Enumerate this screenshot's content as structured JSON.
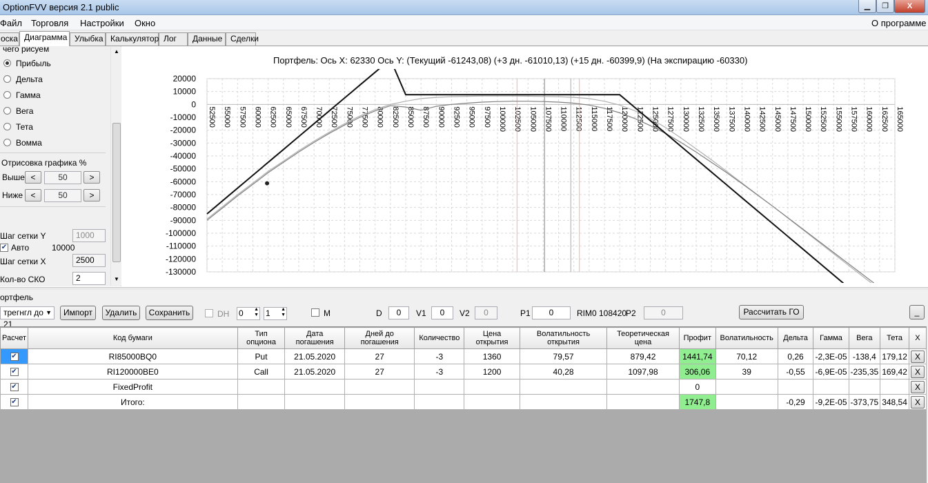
{
  "window": {
    "title": "OptionFVV версия 2.1 public",
    "minimize": "▁",
    "maximize": "❐",
    "close": "X"
  },
  "menu": {
    "items": [
      "Файл",
      "Торговля",
      "Настройки",
      "Окно"
    ],
    "about": "О программе"
  },
  "tabs": [
    "оска",
    "Диаграмма",
    "Улыбка",
    "Калькулятор",
    "Лог",
    "Данные",
    "Сделки"
  ],
  "left_panel": {
    "group_title": "чего рисуем",
    "options": [
      "Прибыль",
      "Дельта",
      "Гамма",
      "Вега",
      "Тета",
      "Вомма"
    ],
    "selected_index": 0,
    "draw_group_title": "Отрисовка графика %",
    "above_label": "Выше",
    "above_value": "50",
    "below_label": "Ниже",
    "below_value": "50",
    "prev_symbol": "<",
    "next_symbol": ">",
    "grid_y_label": "Шаг сетки Y",
    "grid_y_value": "1000",
    "auto_label": "Авто",
    "auto_checked": true,
    "auto_value": "10000",
    "grid_x_label": "Шаг сетки X",
    "grid_x_value": "2500",
    "sko_label": "Кол-во СКО",
    "sko_value": "2"
  },
  "chart_title": "Портфель: Ось X: 62330 Ось Y:  (Текущий -61243,08)  (+3 дн. -61010,13)  (+15 дн. -60399,9)  (На экспирацию -60330)",
  "chart_data": {
    "type": "line",
    "x": [
      52500,
      55000,
      57500,
      60000,
      62500,
      65000,
      67500,
      70000,
      72500,
      75000,
      77500,
      80000,
      82500,
      85000,
      87500,
      90000,
      92500,
      95000,
      97500,
      100000,
      102500,
      105000,
      107500,
      110000,
      112500,
      115000,
      117500,
      120000,
      122500,
      125000,
      127500,
      130000,
      132500,
      135000,
      137500,
      140000,
      145000,
      150000,
      155000,
      160000,
      162500
    ],
    "x_ticks": [
      "52500",
      "55000",
      "57500",
      "60000",
      "62500",
      "65000",
      "67500",
      "70000",
      "72500",
      "75000",
      "77500",
      "80000",
      "82500",
      "85000",
      "87500",
      "90000",
      "92500",
      "95000",
      "97500",
      "100000",
      "102500",
      "105000",
      "107500",
      "110000",
      "112500",
      "115000",
      "117500",
      "120000",
      "122500",
      "125000",
      "127500",
      "130000",
      "132500",
      "135000",
      "137500",
      "140000",
      "142500",
      "145000",
      "147500",
      "150000",
      "152500",
      "155000",
      "157500",
      "160000",
      "162500",
      "165000"
    ],
    "y_ticks": [
      "20000",
      "10000",
      "0",
      "-10000",
      "-20000",
      "-30000",
      "-40000",
      "-50000",
      "-60000",
      "-70000",
      "-80000",
      "-90000",
      "-100000",
      "-110000",
      "-120000",
      "-130000"
    ],
    "xlim": [
      52500,
      165000
    ],
    "ylim": [
      -130000,
      20000
    ],
    "grid": true,
    "series": [
      {
        "color": "#111111",
        "values": [
          -85000,
          -75000,
          -65000,
          -55000,
          -45000,
          -35000,
          -25000,
          -15000,
          -5000,
          5000,
          15000,
          25000,
          35000,
          7500,
          7500,
          7500,
          7500,
          7500,
          7500,
          7500,
          7500,
          7500,
          7500,
          7500,
          7500,
          7500,
          7500,
          7500,
          -2500,
          -12500,
          -22500,
          -32500,
          -42500,
          -52500,
          -62500,
          -72500,
          -92500,
          -112500,
          -132500,
          -152500,
          -162500
        ]
      },
      {
        "color": "#808080",
        "values": [
          -90000,
          -80500,
          -71000,
          -62000,
          -53000,
          -45000,
          -37000,
          -29500,
          -22500,
          -16000,
          -10000,
          -5000,
          -1000,
          -2000,
          -4500,
          -1500,
          0,
          1000,
          1800,
          2200,
          2500,
          2500,
          2200,
          1800,
          1000,
          -500,
          -3000,
          -6500,
          -11000,
          -16500,
          -22500,
          -29500,
          -37000,
          -45000,
          -53000,
          -61500,
          -79000,
          -97000,
          -115000,
          -133000,
          -142000
        ]
      },
      {
        "color": "#b0b0b0",
        "values": [
          -89000,
          -79500,
          -70000,
          -61000,
          -52000,
          -44000,
          -36000,
          -28500,
          -21500,
          -15000,
          -9000,
          -4000,
          0,
          2500,
          4500,
          5500,
          6000,
          6300,
          6500,
          6500,
          6500,
          6400,
          6200,
          6000,
          5500,
          4500,
          2500,
          -500,
          -5000,
          -11000,
          -18000,
          -26000,
          -34500,
          -43000,
          -52000,
          -61000,
          -79000,
          -97500,
          -116000,
          -134500,
          -143500
        ]
      }
    ],
    "vlines": [
      {
        "x": 103200,
        "color": "#ffaaaa"
      },
      {
        "x": 107700,
        "color": "#808080"
      },
      {
        "x": 113400,
        "color": "#ffaaaa"
      },
      {
        "x": 112000,
        "color": "#aaaaaa"
      }
    ],
    "marker": {
      "x": 62330,
      "y": -61243.08
    }
  },
  "portfolio": {
    "group_title": "ортфель",
    "combo_value": "трегнгл до 21",
    "import_label": "Импорт",
    "delete_label": "Удалить",
    "save_label": "Сохранить",
    "dh_label": "DH",
    "dh_value1": "0",
    "dh_value2": "1",
    "m_label": "M",
    "d_label": "D",
    "d_value": "0",
    "v1_label": "V1",
    "v1_value": "0",
    "v2_label": "V2",
    "v2_value": "0",
    "p1_label": "P1",
    "p1_value": "0",
    "rim_label": "RIM0 108420",
    "p2_label": "P2",
    "p2_value": "0",
    "go_label": "Рассчитать ГО",
    "collapse_label": "_"
  },
  "table": {
    "headers": [
      "Расчет",
      "Код бумаги",
      "Тип опциона",
      "Дата погашения",
      "Дней до погашения",
      "Количество",
      "Цена открытия",
      "Волатильность открытия",
      "Теоретическая цена",
      "Профит",
      "Волатильность",
      "Дельта",
      "Гамма",
      "Вега",
      "Тета",
      "X"
    ],
    "rows": [
      [
        "✔",
        "RI85000BQ0",
        "Put",
        "21.05.2020",
        "27",
        "-3",
        "1360",
        "79,57",
        "879,42",
        "1441,74",
        "70,12",
        "0,26",
        "-2,3E-05",
        "-138,4",
        "179,12",
        "X"
      ],
      [
        "✔",
        "RI120000BE0",
        "Call",
        "21.05.2020",
        "27",
        "-3",
        "1200",
        "40,28",
        "1097,98",
        "306,06",
        "39",
        "-0,55",
        "-6,9E-05",
        "-235,35",
        "169,42",
        "X"
      ],
      [
        "✔",
        "FixedProfit",
        "",
        "",
        "",
        "",
        "",
        "",
        "",
        "0",
        "",
        "",
        "",
        "",
        "",
        "X"
      ],
      [
        "✔",
        "Итого:",
        "",
        "",
        "",
        "",
        "",
        "",
        "",
        "1747,8",
        "",
        "-0,29",
        "-9,2E-05",
        "-373,75",
        "348,54",
        "X"
      ]
    ],
    "profit_green_rows": [
      0,
      1,
      3
    ]
  }
}
